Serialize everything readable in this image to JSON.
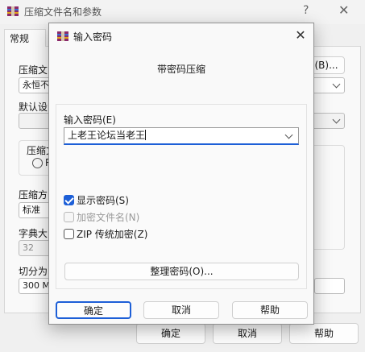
{
  "background_window": {
    "title": "压缩文件名和参数",
    "help_glyph": "?",
    "tab_general": "常规",
    "archive_label_partial": "压缩文",
    "browse_button_partial": "(B)...",
    "update_mode_partial": "永恒不",
    "default_profile_label_partial": "默认设",
    "archive_format_group_partial": "压缩文",
    "radio_partial": "R",
    "method_label_partial": "压缩方",
    "method_value": "标准",
    "dictionary_label_partial": "字典大",
    "dictionary_value": "32",
    "split_label_partial": "切分为",
    "split_value_partial": "300 MB",
    "ok_button": "确定",
    "cancel_button": "取消",
    "help_button": "帮助"
  },
  "dialog": {
    "title": "输入密码",
    "close_glyph": "✕",
    "heading": "带密码压缩",
    "password_label": "输入密码(E)",
    "password_value": "上老王论坛当老王",
    "show_password": {
      "label": "显示密码(S)",
      "checked": true,
      "enabled": true
    },
    "encrypt_filenames": {
      "label": "加密文件名(N)",
      "checked": false,
      "enabled": false
    },
    "zip_legacy": {
      "label": "ZIP 传统加密(Z)",
      "checked": false,
      "enabled": true
    },
    "organize_button": "整理密码(O)...",
    "ok_button": "确定",
    "cancel_button": "取消",
    "help_button": "帮助"
  },
  "colors": {
    "accent": "#1d5fd7"
  }
}
